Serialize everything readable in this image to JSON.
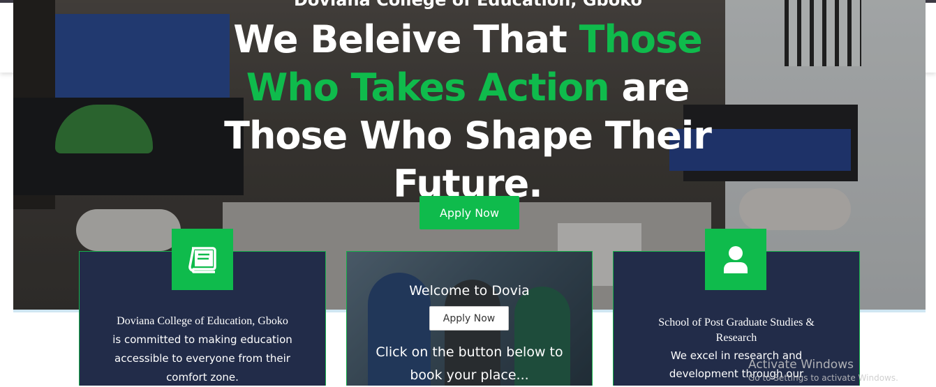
{
  "hero": {
    "subtitle": "Doviana College of Education, Gboko",
    "title_line_1_a": "We Beleive That ",
    "title_line_1_b": "Those",
    "title_line_2_a": "Who Takes Action",
    "title_line_2_b": " are",
    "title_line_3": "Those Who Shape Their",
    "title_line_4": "Future.",
    "apply_button": "Apply Now",
    "accent_color": "#0fbb4c"
  },
  "cards": {
    "card_1": {
      "icon": "book-icon",
      "title": "Doviana College of Education, Gboko",
      "body": "is committed to making education accessible to everyone from their comfort zone."
    },
    "card_2": {
      "welcome": "Welcome to Dovia",
      "button": "Apply Now",
      "body": "Click on the button below to book your place..."
    },
    "card_3": {
      "icon": "user-icon",
      "title": "School of Post Graduate Studies & Research",
      "body": "We excel in research and development through our"
    }
  },
  "watermark": {
    "line_1": "Activate Windows",
    "line_2": "Go to Settings to activate Windows."
  }
}
